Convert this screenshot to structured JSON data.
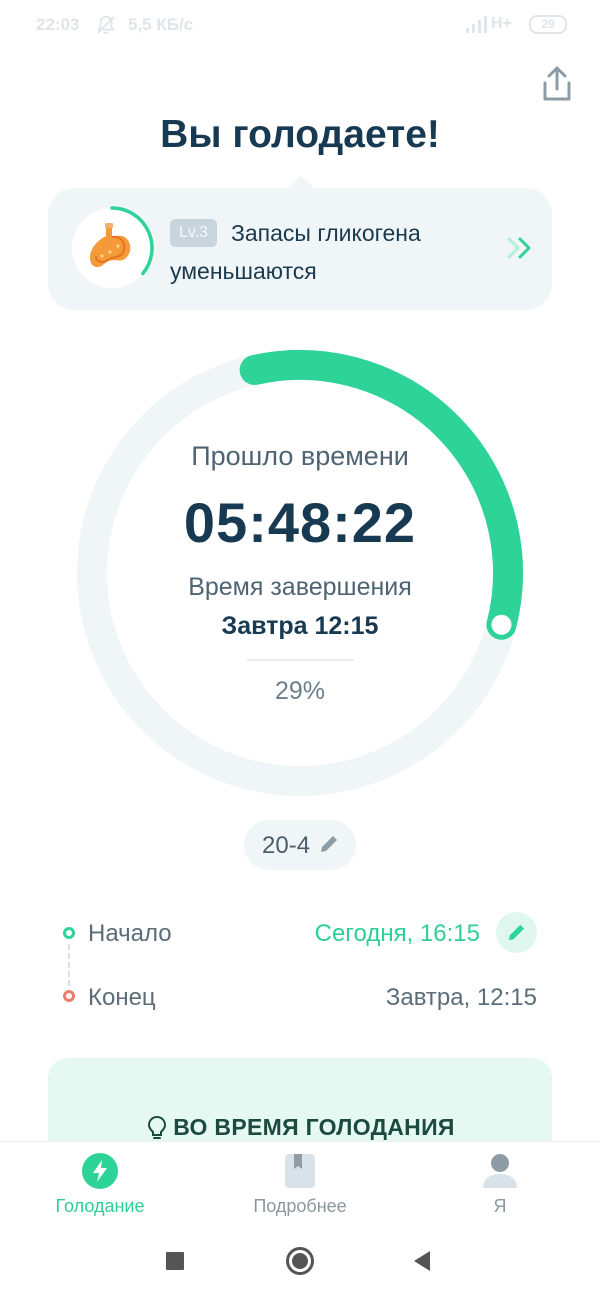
{
  "status_bar": {
    "time": "22:03",
    "speed": "5,5 КБ/с",
    "network": "H+",
    "battery": "29"
  },
  "header": {
    "title": "Вы голодаете!"
  },
  "stage": {
    "level": "Lv.3",
    "title_line1": "Запасы гликогена",
    "title_line2": "уменьшаются",
    "progress": 0.36
  },
  "timer": {
    "elapsed_label": "Прошло времени",
    "elapsed_value": "05:48:22",
    "end_label": "Время завершения",
    "end_value": "Завтра 12:15",
    "percent_text": "29%",
    "progress": 0.29,
    "accent_color": "#2ed398",
    "track_color": "#f0f5f8"
  },
  "plan": {
    "label": "20-4"
  },
  "schedule": {
    "start_label": "Начало",
    "start_value": "Сегодня, 16:15",
    "end_label": "Конец",
    "end_value": "Завтра, 12:15"
  },
  "tips": {
    "title": "ВО ВРЕМЯ ГОЛОДАНИЯ"
  },
  "bottom_nav": {
    "items": [
      {
        "label": "Голодание",
        "icon": "lightning-icon",
        "active": true
      },
      {
        "label": "Подробнее",
        "icon": "bookmark-icon",
        "active": false
      },
      {
        "label": "Я",
        "icon": "person-icon",
        "active": false
      }
    ]
  },
  "colors": {
    "accent": "#2ed398",
    "title": "#173a52",
    "end_dot": "#f07a6e"
  }
}
